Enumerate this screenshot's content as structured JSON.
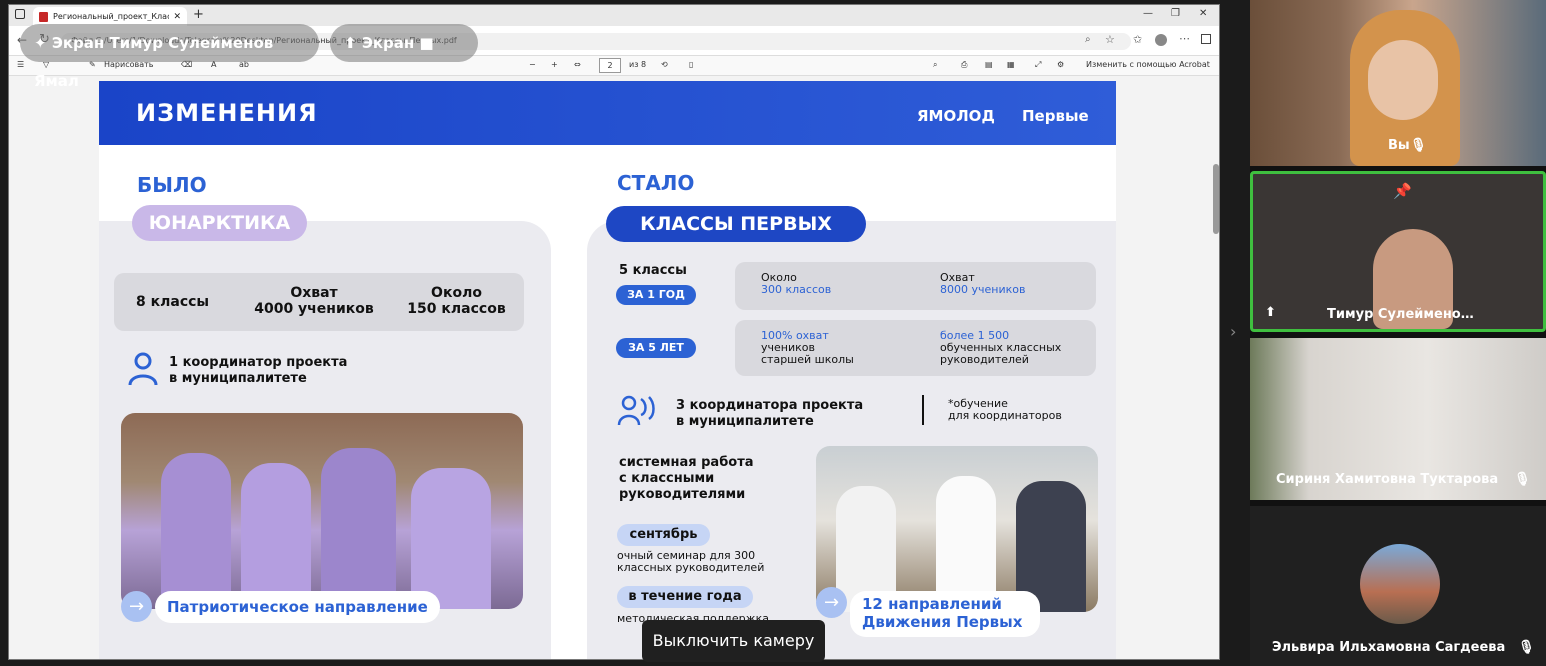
{
  "browser": {
    "tab_title": "Региональный_проект_Классы_П",
    "url": "Файл   C:/Users/1/Downloads/Telegram%20Desktop/Региональный_проект_Классы_Первых.pdf",
    "pdf_toolbar": {
      "draw_label": "Нарисовать",
      "page_current": "2",
      "page_total": "из 8",
      "edit_acrobat": "Изменить с помощью Acrobat"
    }
  },
  "share_bar": {
    "presenter_pill": "Экран Тимур Сулейменов Ямал",
    "screen_pill": "Экран"
  },
  "slide": {
    "header_title": "ИЗМЕНЕНИЯ",
    "header_brand1": "ЯМОЛОД",
    "header_brand2": "Первые",
    "before_label": "БЫЛО",
    "before_program": "ЮНАРКТИКА",
    "before_stats": {
      "classes": "8 классы",
      "reach_line1": "Охват",
      "reach_line2": "4000 учеников",
      "approx_line1": "Около",
      "approx_line2": "150 классов"
    },
    "before_coord_line1": "1 координатор проекта",
    "before_coord_line2": "в муниципалитете",
    "before_caption": "Патриотическое направление",
    "after_label": "СТАЛО",
    "after_program": "КЛАССЫ ПЕРВЫХ",
    "after_classes": "5 классы",
    "year_badge": "ЗА 1 ГОД",
    "year_col1_line1": "Около",
    "year_col1_line2": "300 классов",
    "year_col2_line1": "Охват",
    "year_col2_line2": "8000 учеников",
    "five_badge": "ЗА 5 ЛЕТ",
    "five_col1_line1": "100% охват",
    "five_col1_line2": "учеников",
    "five_col1_line3": "старшей школы",
    "five_col2_line1": "более 1 500",
    "five_col2_line2": "обученных классных",
    "five_col2_line3": "руководителей",
    "after_coord_line1": "3 координатора проекта",
    "after_coord_line2": "в муниципалитете",
    "training_note_line1": "*обучение",
    "training_note_line2": "для координаторов",
    "system_line1": "системная работа",
    "system_line2": "с классными",
    "system_line3": "руководителями",
    "sept_badge": "сентябрь",
    "sept_text_line1": "очный семинар для 300",
    "sept_text_line2": "классных руководителей",
    "year_round_badge": "в течение года",
    "year_round_text": "методическая поддержка",
    "after_caption_line1": "12 направлений",
    "after_caption_line2": "Движения Первых"
  },
  "participants": [
    {
      "name": "Вы",
      "muted": true
    },
    {
      "name": "Тимур Сулейменo…",
      "muted": false
    },
    {
      "name": "Сириня Хамитовна Туктарова",
      "muted": true
    },
    {
      "name": "Эльвира Ильхамовна Сагдеева",
      "muted": true
    }
  ],
  "camera_toast": "Выключить камеру",
  "colors": {
    "accent_blue": "#2c62d4",
    "violet_pill": "#c9b8e8",
    "speaker_border": "#3fbf3f"
  }
}
